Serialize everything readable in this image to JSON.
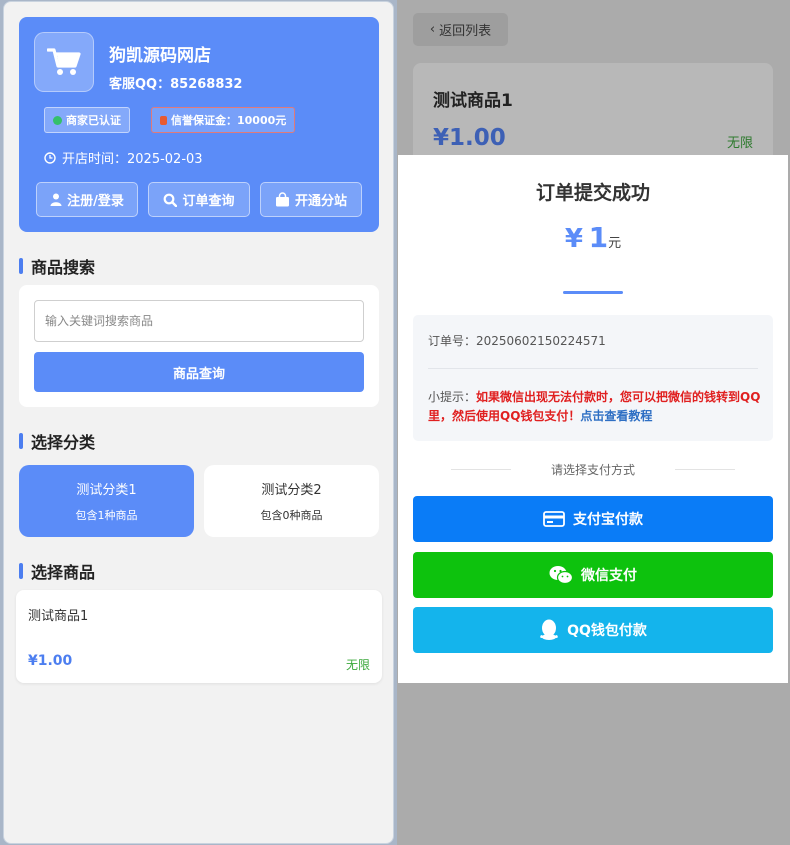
{
  "shop": {
    "name": "狗凯源码网店",
    "qq": "客服QQ：85268832",
    "badge_cert": "商家已认证",
    "badge_deposit": "信誉保证金：10000元",
    "open_time": "开店时间：2025-02-03",
    "buttons": [
      "注册/登录",
      "订单查询",
      "开通分站"
    ]
  },
  "search": {
    "title": "商品搜索",
    "placeholder": "输入关键词搜索商品",
    "button": "商品查询"
  },
  "categories": {
    "title": "选择分类",
    "items": [
      {
        "name": "测试分类1",
        "count": "包含1种商品"
      },
      {
        "name": "测试分类2",
        "count": "包含0种商品"
      }
    ]
  },
  "products": {
    "title": "选择商品",
    "items": [
      {
        "name": "测试商品1",
        "price": "¥1.00",
        "stock": "无限"
      }
    ]
  },
  "detail": {
    "back": "返回列表",
    "title": "测试商品1",
    "price": "¥1.00",
    "stock": "无限"
  },
  "modal": {
    "title": "订单提交成功",
    "amount_symbol": "¥",
    "amount": "1",
    "amount_unit": "元",
    "order_no": "订单号：20250602150224571",
    "tip_label": "小提示：",
    "tip_warn": "如果微信出现无法付款时，您可以把微信的钱转到QQ里，然后使用QQ钱包支付！",
    "tip_link": "点击查看教程",
    "choose_pay": "请选择支付方式",
    "pay_alipay": "支付宝付款",
    "pay_wechat": "微信支付",
    "pay_qq": "QQ钱包付款"
  },
  "colors": {
    "primary": "#5b8cf8",
    "alipay": "#0a7cf7",
    "wechat": "#0dc20d",
    "qq": "#14b4ec",
    "warn": "#e02020"
  }
}
